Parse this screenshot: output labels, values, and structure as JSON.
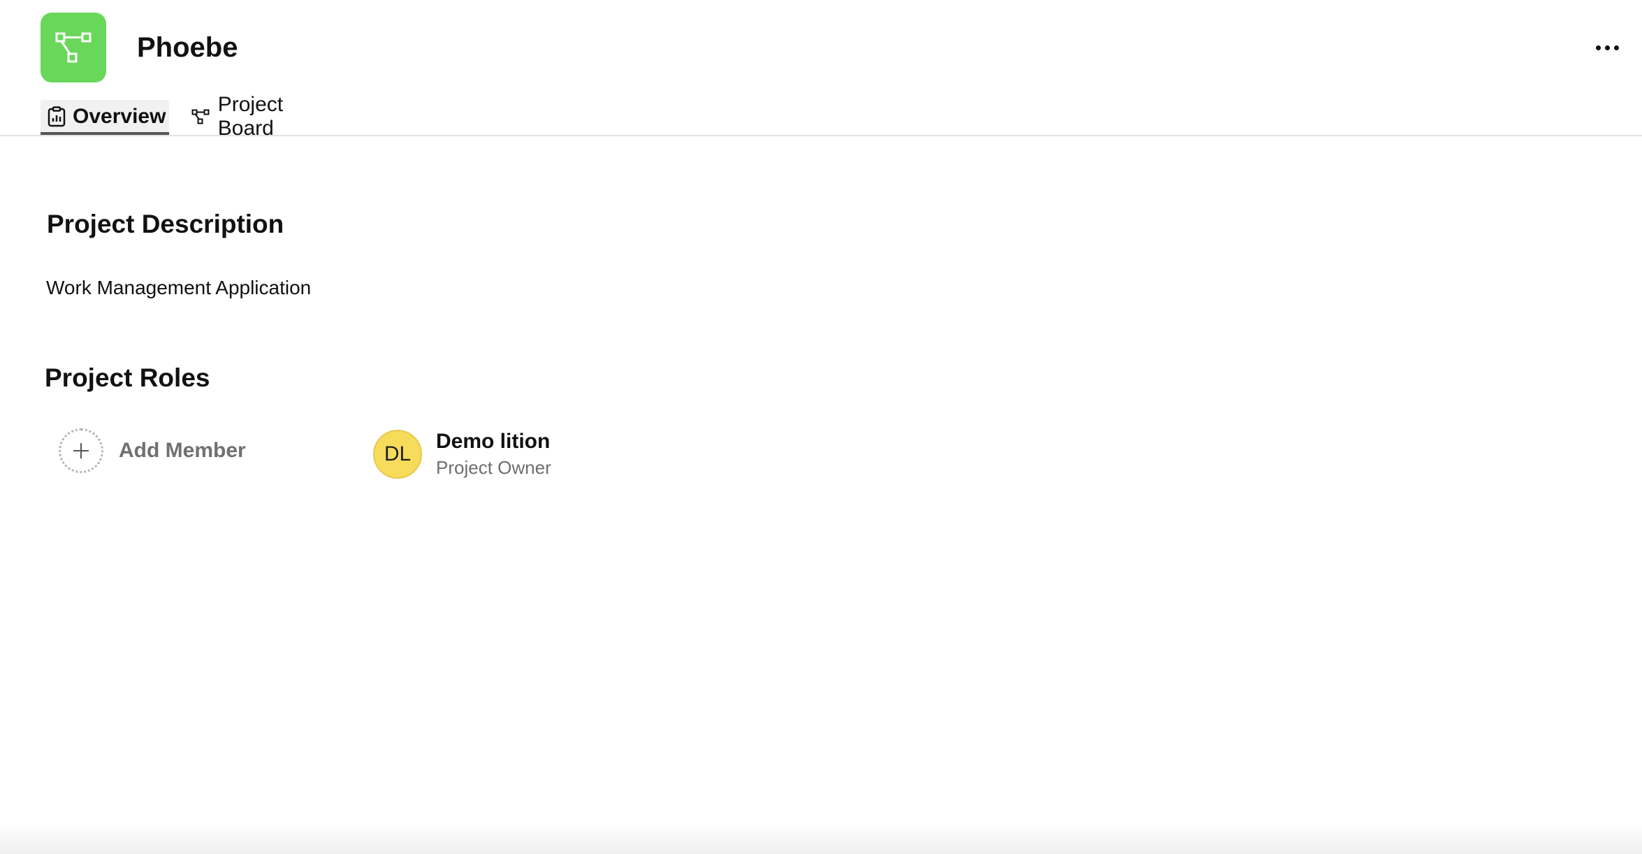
{
  "header": {
    "title": "Phoebe",
    "icon": "project-tree-icon",
    "accent_color": "#69d85a",
    "more_icon": "more-horizontal-icon"
  },
  "tabs": [
    {
      "label": "Overview",
      "icon": "clipboard-chart-icon",
      "active": true
    },
    {
      "label": "Project Board",
      "icon": "project-tree-icon",
      "active": false
    }
  ],
  "description": {
    "title": "Project Description",
    "text": "Work Management Application"
  },
  "roles": {
    "title": "Project Roles",
    "add_member_label": "Add Member",
    "members": [
      {
        "initials": "DL",
        "name": "Demo lition",
        "role": "Project Owner",
        "avatar_color": "#f7dc5c"
      }
    ]
  }
}
